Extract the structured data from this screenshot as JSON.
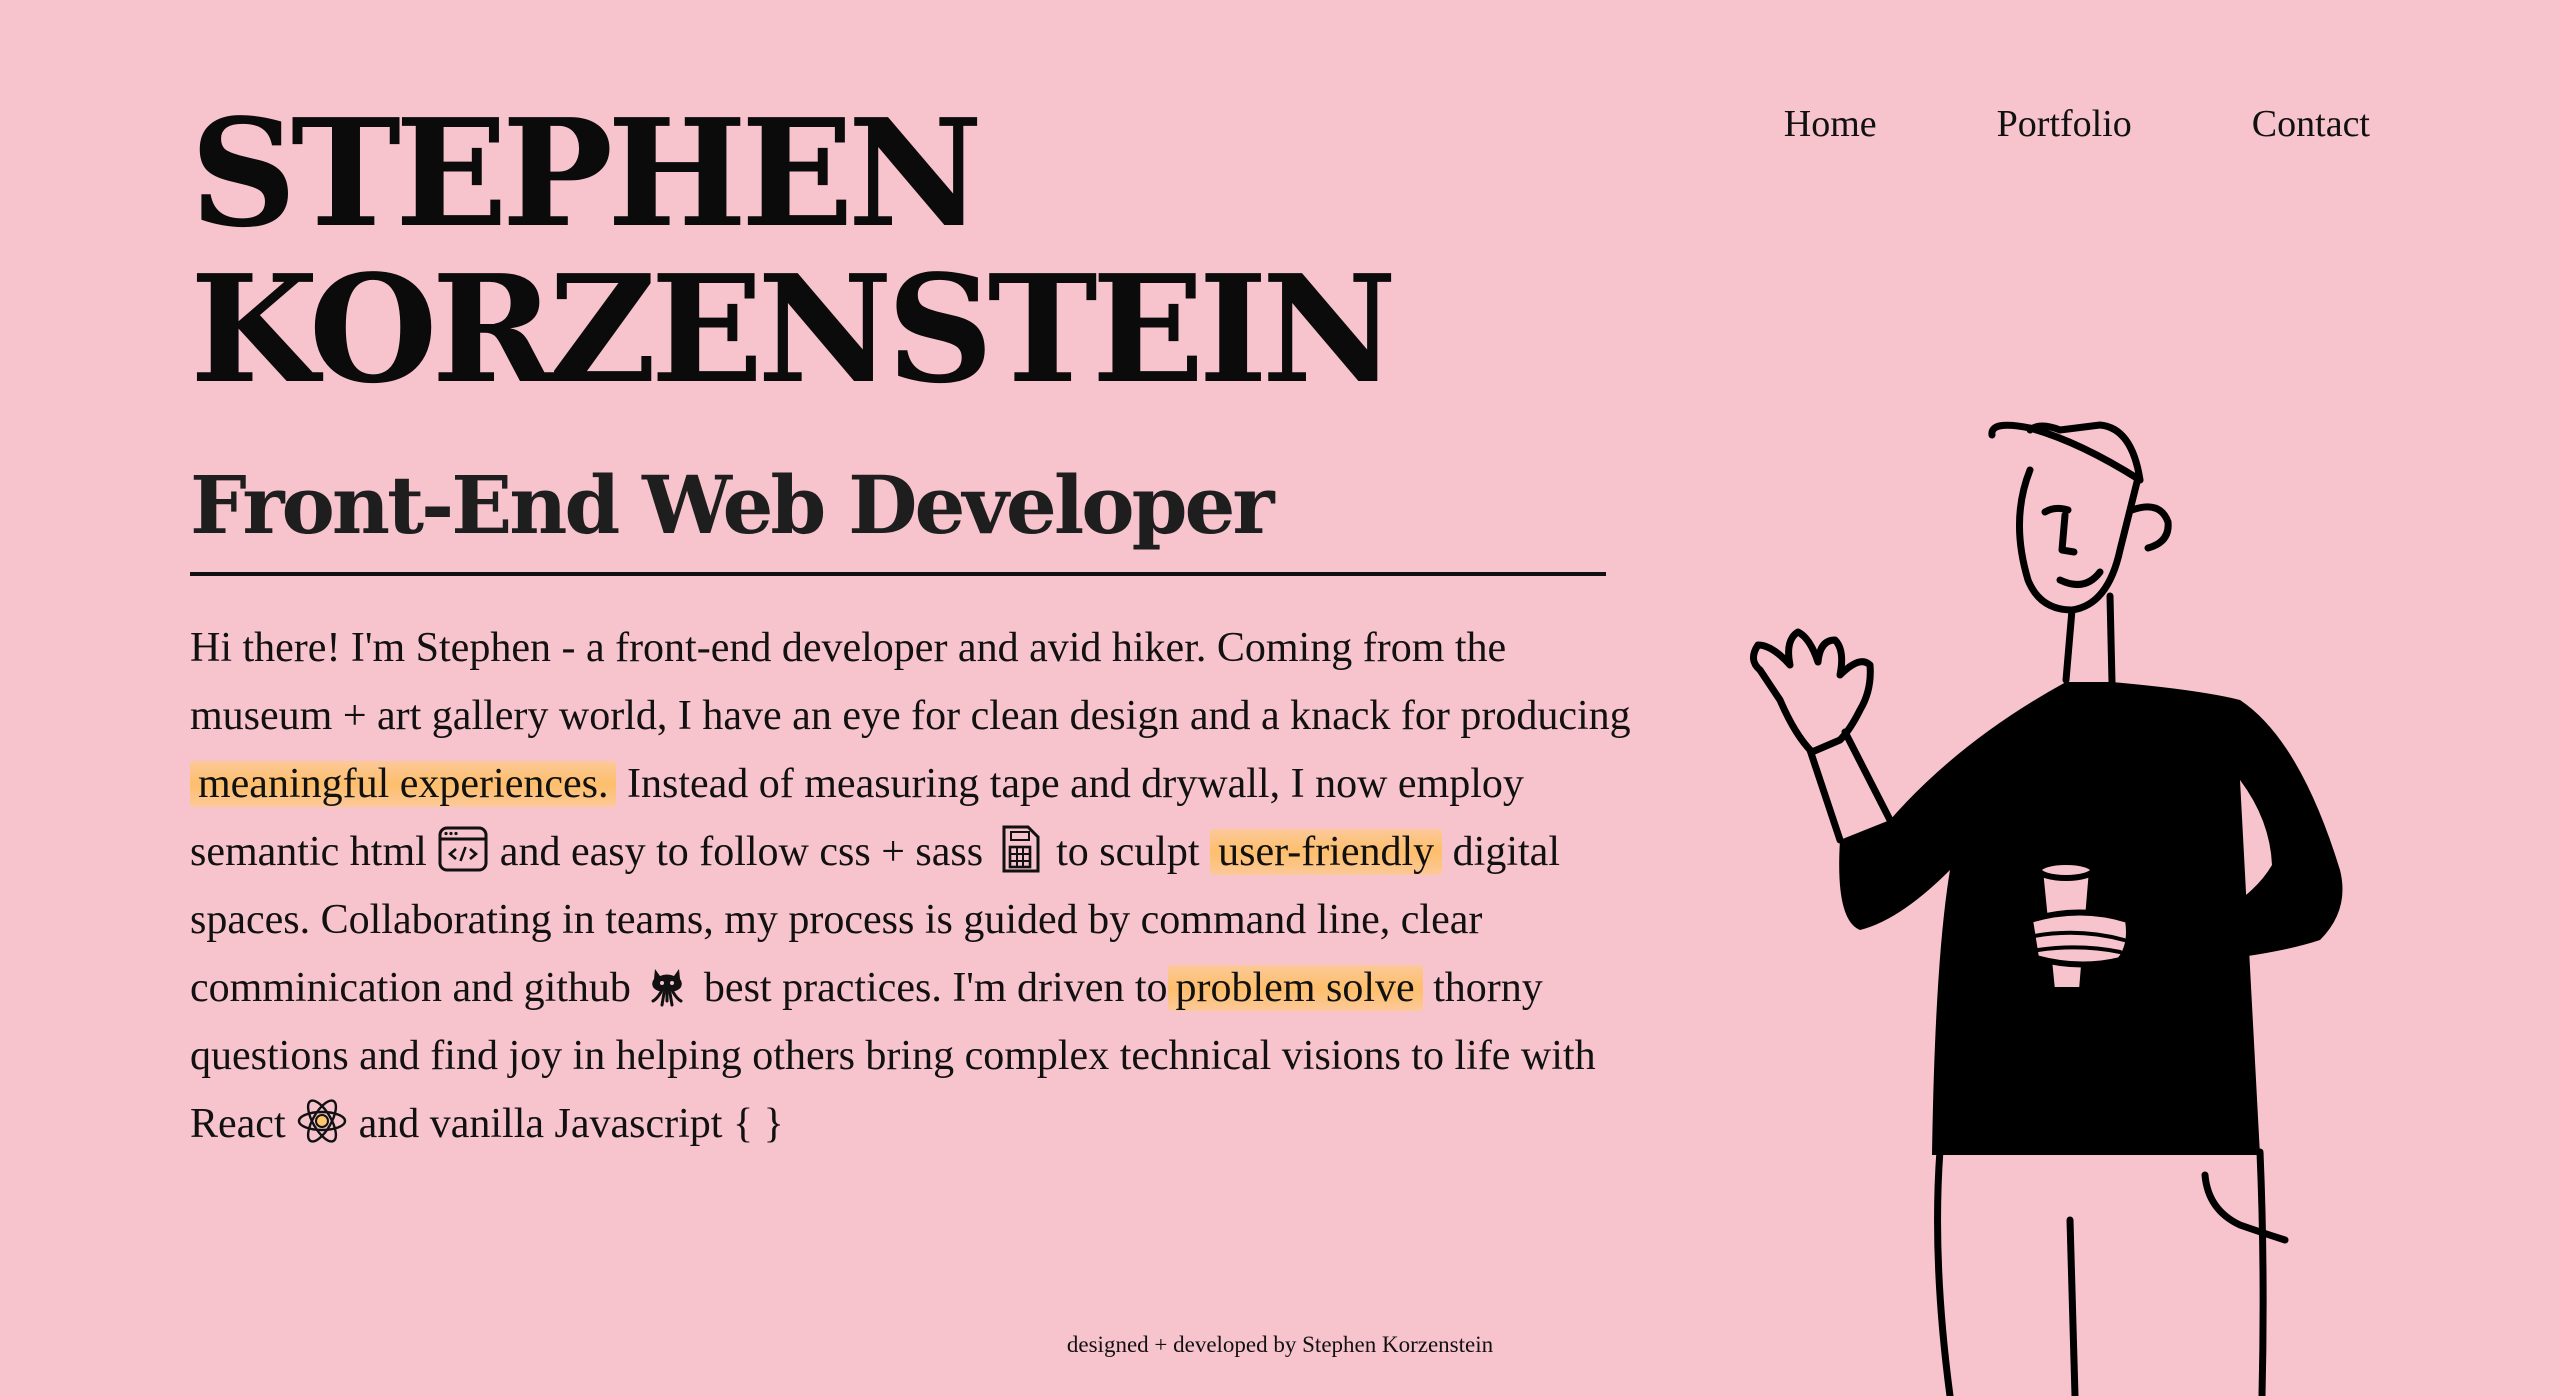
{
  "header": {
    "name_line1": "STEPHEN",
    "name_line2": "KORZENSTEIN"
  },
  "nav": {
    "items": [
      {
        "label": "Home"
      },
      {
        "label": "Portfolio"
      },
      {
        "label": "Contact"
      }
    ]
  },
  "hero": {
    "subtitle": "Front-End Web Developer",
    "bio": {
      "part1": "Hi there! I'm Stephen - a front-end developer and avid hiker. Coming from the museum + art gallery world, I have an eye for clean design and a knack for producing ",
      "highlight1": "meaningful experiences.",
      "part2": " Instead of measuring tape and drywall, I now employ semantic html ",
      "part3": " and easy to follow css + sass ",
      "part4": " to sculpt ",
      "highlight2": "user-friendly",
      "part5": " digital spaces. Collaborating in teams, my process is guided by command line, clear comminication and github ",
      "part6": " best practices. I'm driven to",
      "highlight3": "problem solve",
      "part7": " thorny questions and find joy in helping others bring complex technical visions to life with React ",
      "part8": " and vanilla Javascript { }"
    },
    "icons": [
      "html-code-icon",
      "css-file-icon",
      "github-octocat-icon",
      "react-atom-icon"
    ],
    "highlight_color": "#ffc76a"
  },
  "illustration": {
    "icon": "person-waving-with-coffee-illustration"
  },
  "footer": {
    "credit": "designed + developed by Stephen Korzenstein"
  },
  "colors": {
    "background": "#f7c3cd",
    "text": "#111111"
  }
}
